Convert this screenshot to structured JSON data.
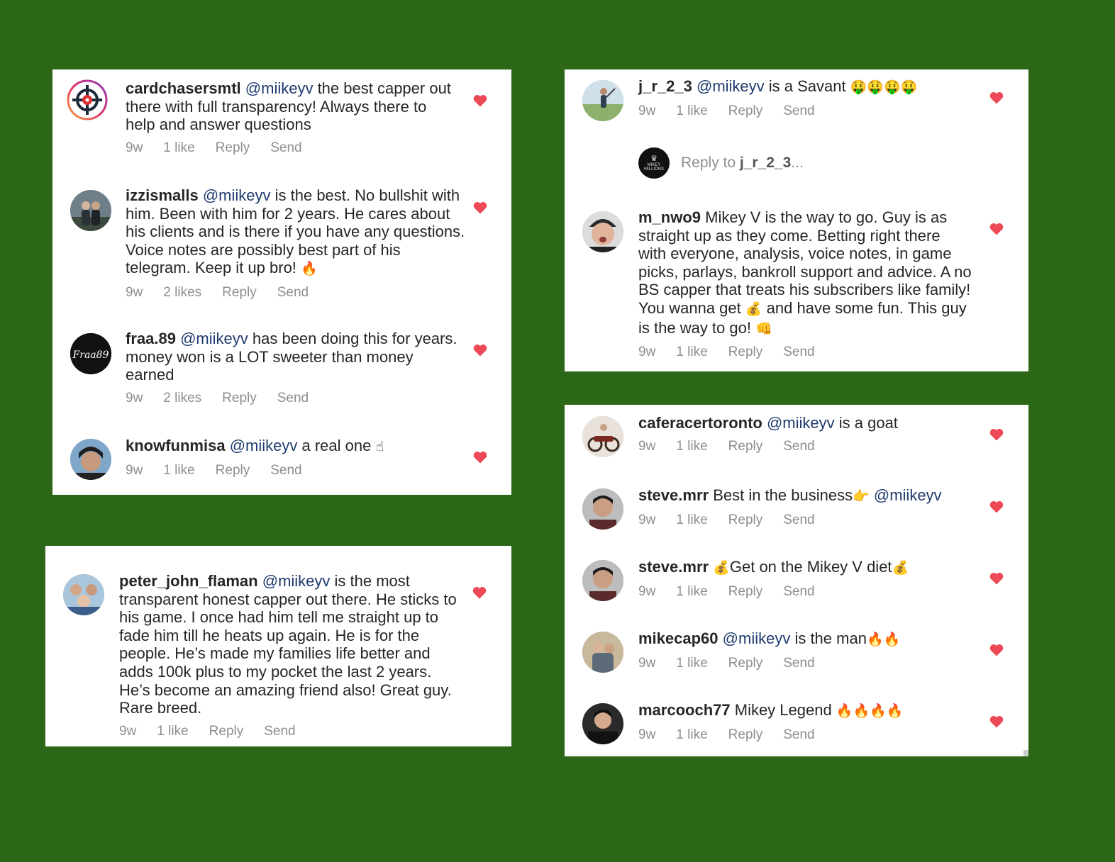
{
  "colors": {
    "background": "#2b6717",
    "card": "#ffffff",
    "heart": "#ed4956",
    "mention": "#1f3b6e",
    "meta": "#8e8e8e"
  },
  "card_a": {
    "comments": [
      {
        "username": "cardchasersmtl",
        "mention": "@miikeyv",
        "text": " the best capper out there with full transparency! Always there to help and answer questions",
        "time": "9w",
        "likes": "1 like",
        "reply": "Reply",
        "send": "Send",
        "avatar_icon": "target-logo-icon"
      },
      {
        "username": "izzismalls",
        "mention": "@miikeyv",
        "text": " is the best. No bullshit with him. Been with him for 2 years. He cares about his clients and is there if you have any questions. Voice notes are possibly best part of his telegram. Keep it up bro! ",
        "emoji": "🔥",
        "time": "9w",
        "likes": "2 likes",
        "reply": "Reply",
        "send": "Send"
      },
      {
        "username": "fraa.89",
        "mention": "@miikeyv",
        "text": " has been doing this for years. money won is a LOT sweeter than money earned",
        "time": "9w",
        "likes": "2 likes",
        "reply": "Reply",
        "send": "Send",
        "avatar_text": "Fraa89"
      },
      {
        "username": "knowfunmisa",
        "mention": "@miikeyv",
        "text": " a real one ",
        "emoji": "☝",
        "time": "9w",
        "likes": "1 like",
        "reply": "Reply",
        "send": "Send"
      }
    ]
  },
  "card_b": {
    "comments": [
      {
        "username": "peter_john_flaman",
        "mention": "@miikeyv",
        "text": " is the most transparent honest capper out there. He sticks to his game. I once had him tell me straight up to fade him till he heats up again. He is for the people. He’s made my families life better and adds 100k plus to my pocket the last 2 years. He’s become an amazing friend also! Great guy. Rare breed.",
        "time": "9w",
        "likes": "1 like",
        "reply": "Reply",
        "send": "Send"
      }
    ]
  },
  "card_c": {
    "comments": [
      {
        "username": "j_r_2_3",
        "mention": "@miikeyv",
        "text": " is a Savant ",
        "emoji": "🤑🤑🤑🤑",
        "time": "9w",
        "likes": "1 like",
        "reply": "Reply",
        "send": "Send"
      },
      {
        "username": "m_nwo9",
        "text": " Mikey V is the way to go.  Guy is as straight up as they come.  Betting right there with everyone, analysis, voice notes, in game picks, parlays, bankroll support and advice.  A no BS capper that treats his subscribers like family! You wanna get ",
        "emoji": "💰",
        "text2": " and have some fun. This guy is the way to go! ",
        "emoji2": "👊",
        "time": "9w",
        "likes": "1 like",
        "reply": "Reply",
        "send": "Send"
      }
    ],
    "reply_box": {
      "prefix": "Reply to ",
      "target": "j_r_2_3",
      "suffix": "...",
      "avatar_label": "MIKEY MILLIONS"
    }
  },
  "card_d": {
    "comments": [
      {
        "username": "caferacertoronto",
        "mention": "@miikeyv",
        "text": " is a goat",
        "time": "9w",
        "likes": "1 like",
        "reply": "Reply",
        "send": "Send"
      },
      {
        "username": "steve.mrr",
        "text": " Best in the business",
        "emoji": "👉",
        "mention": " @miikeyv",
        "time": "9w",
        "likes": "1 like",
        "reply": "Reply",
        "send": "Send"
      },
      {
        "username": "steve.mrr",
        "emoji": "💰",
        "text": "Get on the Mikey V diet",
        "emoji2": "💰",
        "time": "9w",
        "likes": "1 like",
        "reply": "Reply",
        "send": "Send"
      },
      {
        "username": "mikecap60",
        "mention": "@miikeyv",
        "text": " is the man",
        "emoji": "🔥🔥",
        "time": "9w",
        "likes": "1 like",
        "reply": "Reply",
        "send": "Send"
      },
      {
        "username": "marcooch77",
        "text": " Mikey Legend ",
        "emoji": "🔥🔥🔥🔥",
        "time": "9w",
        "likes": "1 like",
        "reply": "Reply",
        "send": "Send"
      }
    ]
  }
}
